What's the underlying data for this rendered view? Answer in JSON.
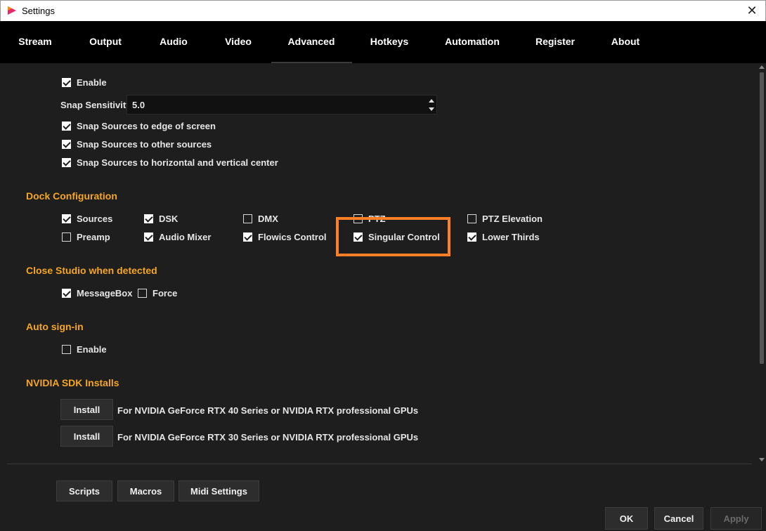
{
  "window": {
    "title": "Settings",
    "close_symbol": "✕"
  },
  "tabs": [
    {
      "label": "Stream"
    },
    {
      "label": "Output"
    },
    {
      "label": "Audio"
    },
    {
      "label": "Video"
    },
    {
      "label": "Advanced",
      "active": true
    },
    {
      "label": "Hotkeys"
    },
    {
      "label": "Automation"
    },
    {
      "label": "Register"
    },
    {
      "label": "About"
    }
  ],
  "snapping": {
    "enable": {
      "label": "Enable",
      "checked": true
    },
    "sensitivity_label": "Snap Sensitivity",
    "sensitivity_value": "5.0",
    "edge": {
      "label": "Snap Sources to edge of screen",
      "checked": true
    },
    "other": {
      "label": "Snap Sources to other sources",
      "checked": true
    },
    "center": {
      "label": "Snap Sources to horizontal and vertical center",
      "checked": true
    }
  },
  "dock": {
    "title": "Dock Configuration",
    "items": [
      {
        "label": "Sources",
        "checked": true
      },
      {
        "label": "DSK",
        "checked": true
      },
      {
        "label": "DMX",
        "checked": false
      },
      {
        "label": "PTZ",
        "checked": false
      },
      {
        "label": "PTZ Elevation",
        "checked": false
      },
      {
        "label": "Preamp",
        "checked": false
      },
      {
        "label": "Audio Mixer",
        "checked": true
      },
      {
        "label": "Flowics Control",
        "checked": true
      },
      {
        "label": "Singular Control",
        "checked": true
      },
      {
        "label": "Lower Thirds",
        "checked": true
      }
    ]
  },
  "close_studio": {
    "title": "Close Studio when detected",
    "messagebox": {
      "label": "MessageBox",
      "checked": true
    },
    "force": {
      "label": "Force",
      "checked": false
    }
  },
  "auto_signin": {
    "title": "Auto sign-in",
    "enable": {
      "label": "Enable",
      "checked": false
    }
  },
  "nvidia": {
    "title": "NVIDIA SDK Installs",
    "rows": [
      {
        "button": "Install",
        "text": "For NVIDIA GeForce RTX 40 Series or NVIDIA RTX professional GPUs"
      },
      {
        "button": "Install",
        "text": "For NVIDIA GeForce RTX 30 Series or NVIDIA RTX professional GPUs"
      }
    ]
  },
  "bottom_buttons": {
    "scripts": "Scripts",
    "macros": "Macros",
    "midi": "Midi Settings"
  },
  "dialog_buttons": {
    "ok": "OK",
    "cancel": "Cancel",
    "apply": "Apply"
  },
  "colors": {
    "accent": "#f5a623",
    "highlight": "#ff7f27",
    "background": "#1e1e1e",
    "tabbar": "#000000"
  }
}
